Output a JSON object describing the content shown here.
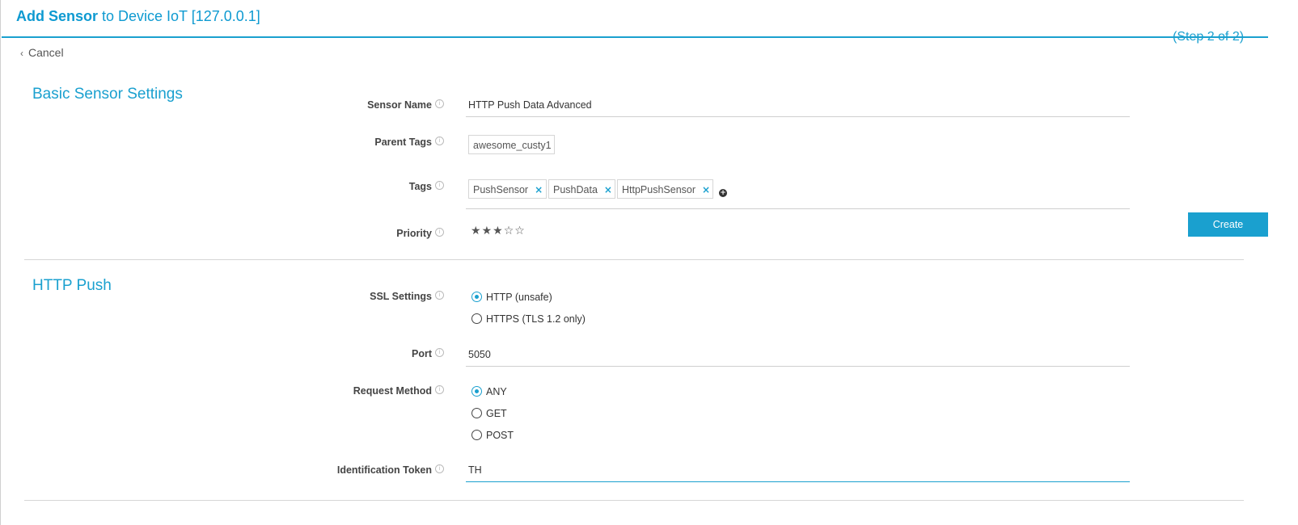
{
  "header": {
    "title_strong": "Add Sensor",
    "title_rest": " to Device IoT [127.0.0.1]",
    "step": "(Step 2 of 2)",
    "cancel_label": "Cancel"
  },
  "actions": {
    "create_label": "Create"
  },
  "basic": {
    "section_title": "Basic Sensor Settings",
    "sensor_name": {
      "label": "Sensor Name",
      "value": "HTTP Push Data Advanced"
    },
    "parent_tags": {
      "label": "Parent Tags",
      "values": [
        "awesome_custy1"
      ]
    },
    "tags": {
      "label": "Tags",
      "values": [
        "PushSensor",
        "PushData",
        "HttpPushSensor"
      ],
      "remove_symbol": "×",
      "add_symbol": "+"
    },
    "priority": {
      "label": "Priority",
      "value": 3,
      "max": 5,
      "filled_symbol": "★",
      "empty_symbol": "☆"
    }
  },
  "http_push": {
    "section_title": "HTTP Push",
    "ssl": {
      "label": "SSL Settings",
      "options": [
        "HTTP (unsafe)",
        "HTTPS (TLS 1.2 only)"
      ],
      "selected": "HTTP (unsafe)"
    },
    "port": {
      "label": "Port",
      "value": "5050"
    },
    "request_method": {
      "label": "Request Method",
      "options": [
        "ANY",
        "GET",
        "POST"
      ],
      "selected": "ANY"
    },
    "token": {
      "label": "Identification Token",
      "value": "TH"
    }
  },
  "icons": {
    "info": "info-icon",
    "back": "chevron-left-icon",
    "remove": "close-icon",
    "add": "plus-circle-icon",
    "star": "star-icon"
  },
  "colors": {
    "accent": "#1aa0cf",
    "text": "#333333",
    "border": "#cfcfcf"
  }
}
